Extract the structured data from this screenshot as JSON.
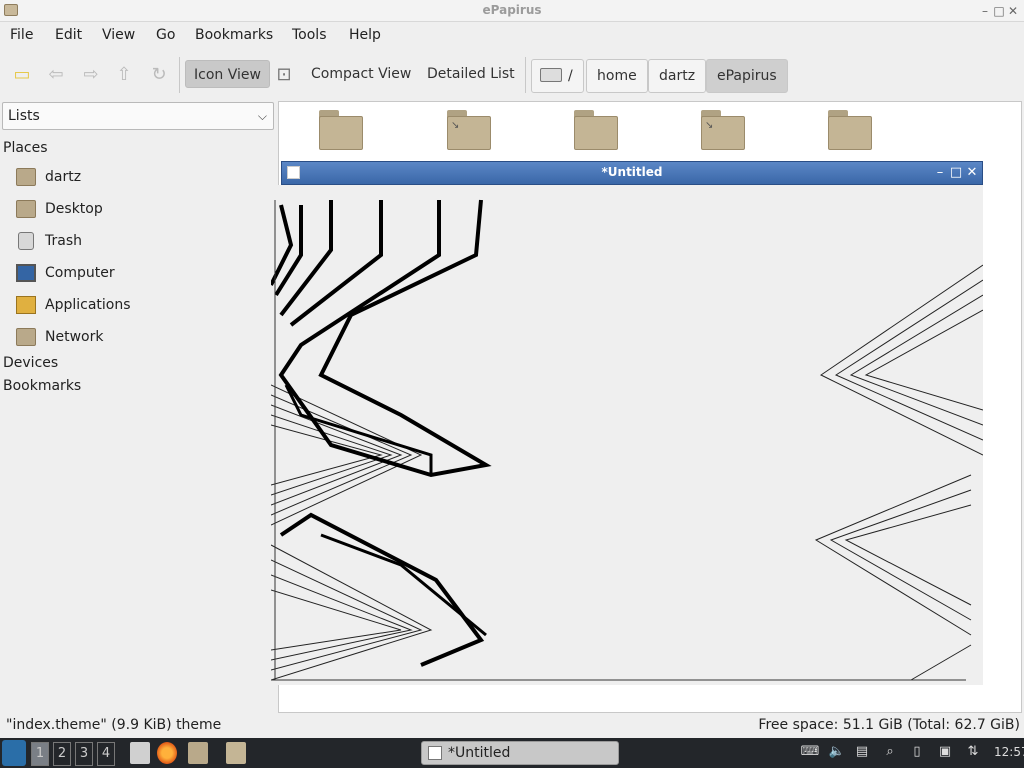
{
  "window": {
    "title": "ePapirus",
    "min": "–",
    "max": "□",
    "close": "✕"
  },
  "menu": [
    "File",
    "Edit",
    "View",
    "Go",
    "Bookmarks",
    "Tools",
    "Help"
  ],
  "toolbar": {
    "icon_view": "Icon View",
    "compact_view": "Compact View",
    "detailed_list": "Detailed List",
    "path": [
      "/",
      "home",
      "dartz",
      "ePapirus"
    ]
  },
  "sidebar": {
    "select_value": "Lists",
    "places_label": "Places",
    "items": [
      "dartz",
      "Desktop",
      "Trash",
      "Computer",
      "Applications",
      "Network"
    ],
    "devices_label": "Devices",
    "bookmarks_label": "Bookmarks"
  },
  "untitled_window": {
    "title": "*Untitled",
    "min": "–",
    "max": "□",
    "close": "✕"
  },
  "status": {
    "left": "\"index.theme\" (9.9 KiB) theme",
    "right": "Free space: 51.1 GiB (Total: 62.7 GiB)"
  },
  "taskbar": {
    "workspaces": [
      "1",
      "2",
      "3",
      "4"
    ],
    "task_label": "*Untitled",
    "clock": "12:57"
  }
}
